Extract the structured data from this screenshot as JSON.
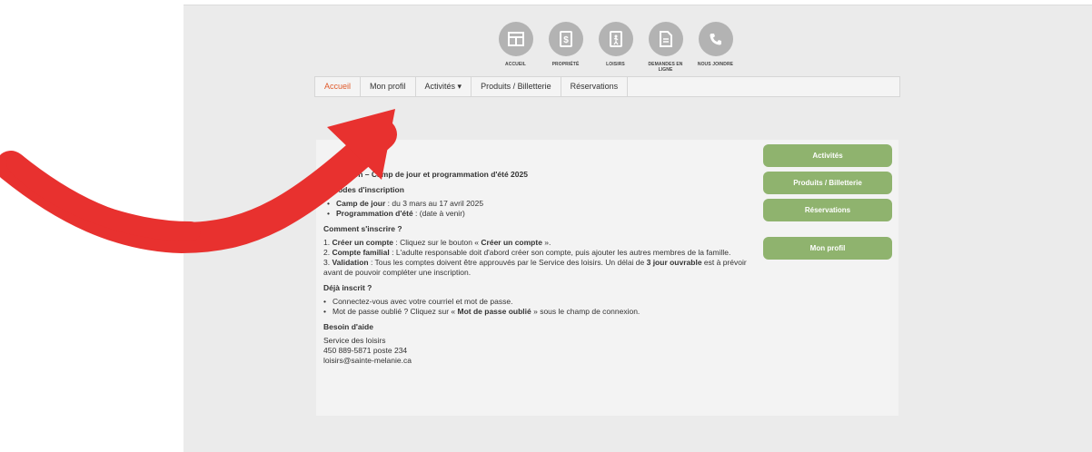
{
  "top_icons": [
    {
      "icon": "home-icon",
      "label": "ACCUEIL"
    },
    {
      "icon": "dollar-icon",
      "label": "PROPRIÉTÉ"
    },
    {
      "icon": "leisure-icon",
      "label": "LOISIRS"
    },
    {
      "icon": "document-icon",
      "label": "DEMANDES EN LIGNE"
    },
    {
      "icon": "phone-icon",
      "label": "NOUS JOINDRE"
    }
  ],
  "nav": {
    "items": [
      "Accueil",
      "Mon profil",
      "Activités ▾",
      "Produits / Billetterie",
      "Réservations"
    ]
  },
  "content": {
    "title": "Inscription – Camp de jour et programmation d'été 2025",
    "periods_heading": "Périodes d'inscription",
    "period1_label": "Camp de jour",
    "period1_value": " : du 3 mars au 17 avril 2025",
    "period2_label": "Programmation d'été",
    "period2_value": " : (date à venir)",
    "how_heading": "Comment s'inscrire ?",
    "step1_pre": "1. ",
    "step1_label": "Créer un compte",
    "step1_text": " : Cliquez sur le bouton « ",
    "step1_btn": "Créer un compte",
    "step1_end": " ».",
    "step2_pre": "2. ",
    "step2_label": "Compte familial",
    "step2_text": " : L'adulte responsable doit d'abord créer son compte, puis ajouter les autres membres de la famille.",
    "step3_pre": "3. ",
    "step3_label": "Validation",
    "step3_text": " : Tous les comptes doivent être approuvés par le Service des loisirs. Un délai de ",
    "step3_bold": "3 jour ouvrable",
    "step3_end": " est à prévoir avant de pouvoir compléter une inscription.",
    "already_heading": "Déjà inscrit ?",
    "bullet1": "Connectez-vous avec votre courriel et mot de passe.",
    "bullet2_pre": "Mot de passe oublié ? Cliquez sur « ",
    "bullet2_bold": "Mot de passe oublié",
    "bullet2_end": " » sous le champ de connexion.",
    "help_heading": "Besoin d'aide",
    "help_line1": "Service des loisirs",
    "help_line2": "450 889-5871 poste 234",
    "help_line3": "loisirs@sainte-melanie.ca"
  },
  "sidebar": {
    "btn_activities": "Activités",
    "btn_products": "Produits / Billetterie",
    "btn_reservations": "Réservations",
    "btn_profile": "Mon profil"
  },
  "colors": {
    "accent": "#e05a2b",
    "button": "#8fb36e",
    "arrow": "#e8312f"
  }
}
